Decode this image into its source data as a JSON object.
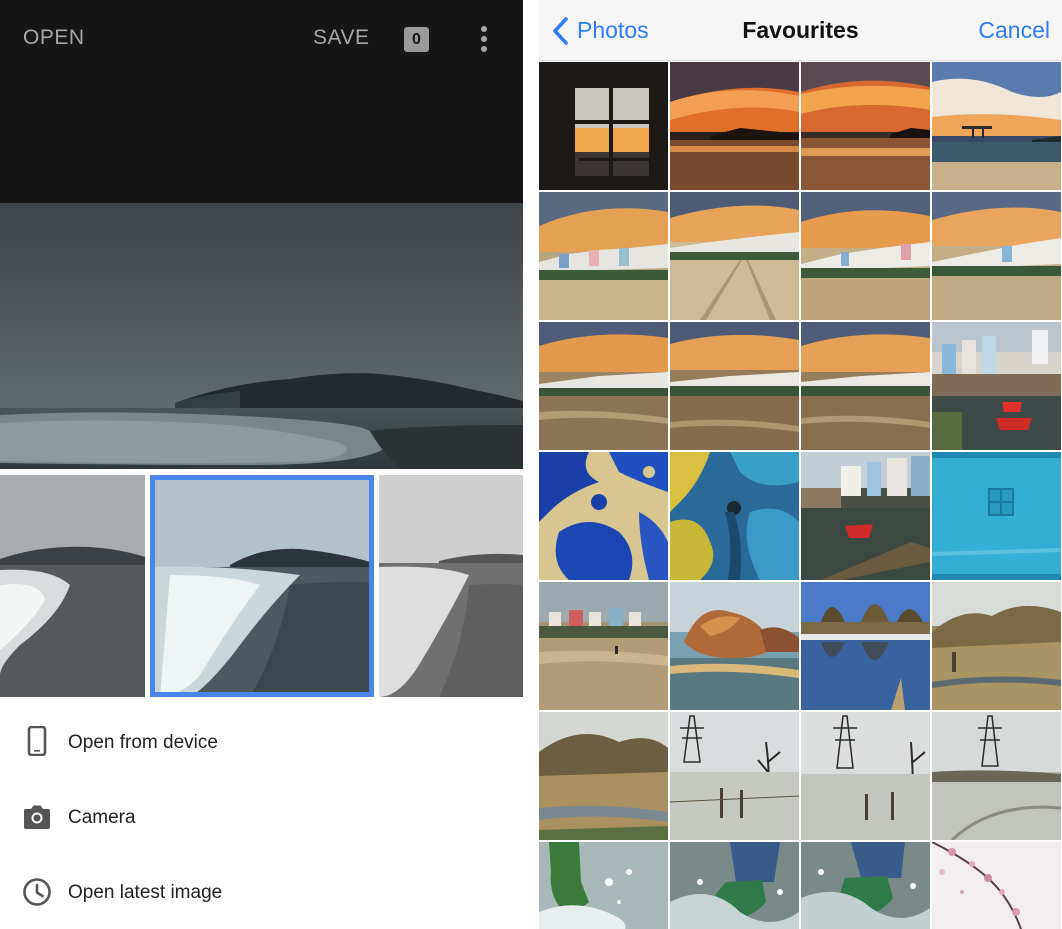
{
  "editor": {
    "toolbar": {
      "open_label": "OPEN",
      "save_label": "SAVE",
      "count": "0",
      "more_icon": "more-vert-icon"
    },
    "colors": {
      "toolbar_bg": "#161616",
      "toolbar_text": "#a7a7a7",
      "selection": "#4a86e8"
    },
    "thumbnails_selected_index": 1,
    "menu": [
      {
        "label": "Open from device",
        "icon": "phone-icon"
      },
      {
        "label": "Camera",
        "icon": "camera-icon"
      },
      {
        "label": "Open latest image",
        "icon": "clock-icon"
      }
    ]
  },
  "picker": {
    "back_label": "Photos",
    "title": "Favourites",
    "cancel_label": "Cancel",
    "accent": "#2f7cf6",
    "photos": [
      "window-sunset",
      "orange-sunset-sea",
      "sunset-island",
      "cloudy-sunset-pier",
      "harbour-sunset-1",
      "beach-tracks",
      "harbour-sunset-2",
      "harbour-sunset-3",
      "harbour-wet-sand-1",
      "harbour-wet-sand-2",
      "harbour-wet-sand-3",
      "harbour-red-boats",
      "blue-peeling-paint",
      "blue-yellow-paint",
      "harbour-boats",
      "turquoise-door",
      "beach-houses",
      "sea-rock",
      "river-reflection",
      "mountain-valley",
      "mountain-stream",
      "pylon-fence-tree",
      "pylon-snowy-field",
      "pylon-snowy-track",
      "green-boots-splash",
      "boot-splash-jeans",
      "boot-splash-jeans-2",
      "pink-blossom"
    ]
  }
}
